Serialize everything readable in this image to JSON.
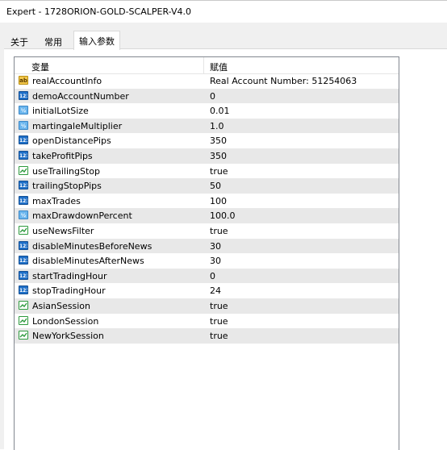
{
  "window": {
    "title": "Expert - 1728ORION-GOLD-SCALPER-V4.0"
  },
  "tabs": [
    {
      "label": "关于"
    },
    {
      "label": "常用"
    },
    {
      "label": "输入参数"
    }
  ],
  "grid": {
    "columns": [
      "变量",
      "赋值"
    ],
    "rows": [
      {
        "name": "realAccountInfo",
        "value": "Real Account Number: 51254063",
        "type_icon": "string-icon",
        "icon_text": "ab"
      },
      {
        "name": "demoAccountNumber",
        "value": "0",
        "type_icon": "integer-icon",
        "icon_text": "123"
      },
      {
        "name": "initialLotSize",
        "value": "0.01",
        "type_icon": "double-icon",
        "icon_text": "½"
      },
      {
        "name": "martingaleMultiplier",
        "value": "1.0",
        "type_icon": "double-icon",
        "icon_text": "½"
      },
      {
        "name": "openDistancePips",
        "value": "350",
        "type_icon": "integer-icon",
        "icon_text": "123"
      },
      {
        "name": "takeProfitPips",
        "value": "350",
        "type_icon": "integer-icon",
        "icon_text": "123"
      },
      {
        "name": "useTrailingStop",
        "value": "true",
        "type_icon": "bool-icon",
        "icon_text": ""
      },
      {
        "name": "trailingStopPips",
        "value": "50",
        "type_icon": "integer-icon",
        "icon_text": "123"
      },
      {
        "name": "maxTrades",
        "value": "100",
        "type_icon": "integer-icon",
        "icon_text": "123"
      },
      {
        "name": "maxDrawdownPercent",
        "value": "100.0",
        "type_icon": "double-icon",
        "icon_text": "½"
      },
      {
        "name": "useNewsFilter",
        "value": "true",
        "type_icon": "bool-icon",
        "icon_text": ""
      },
      {
        "name": "disableMinutesBeforeNews",
        "value": "30",
        "type_icon": "integer-icon",
        "icon_text": "123"
      },
      {
        "name": "disableMinutesAfterNews",
        "value": "30",
        "type_icon": "integer-icon",
        "icon_text": "123"
      },
      {
        "name": "startTradingHour",
        "value": "0",
        "type_icon": "integer-icon",
        "icon_text": "123"
      },
      {
        "name": "stopTradingHour",
        "value": "24",
        "type_icon": "integer-icon",
        "icon_text": "123"
      },
      {
        "name": "AsianSession",
        "value": "true",
        "type_icon": "bool-icon",
        "icon_text": ""
      },
      {
        "name": "LondonSession",
        "value": "true",
        "type_icon": "bool-icon",
        "icon_text": ""
      },
      {
        "name": "NewYorkSession",
        "value": "true",
        "type_icon": "bool-icon",
        "icon_text": ""
      }
    ]
  }
}
